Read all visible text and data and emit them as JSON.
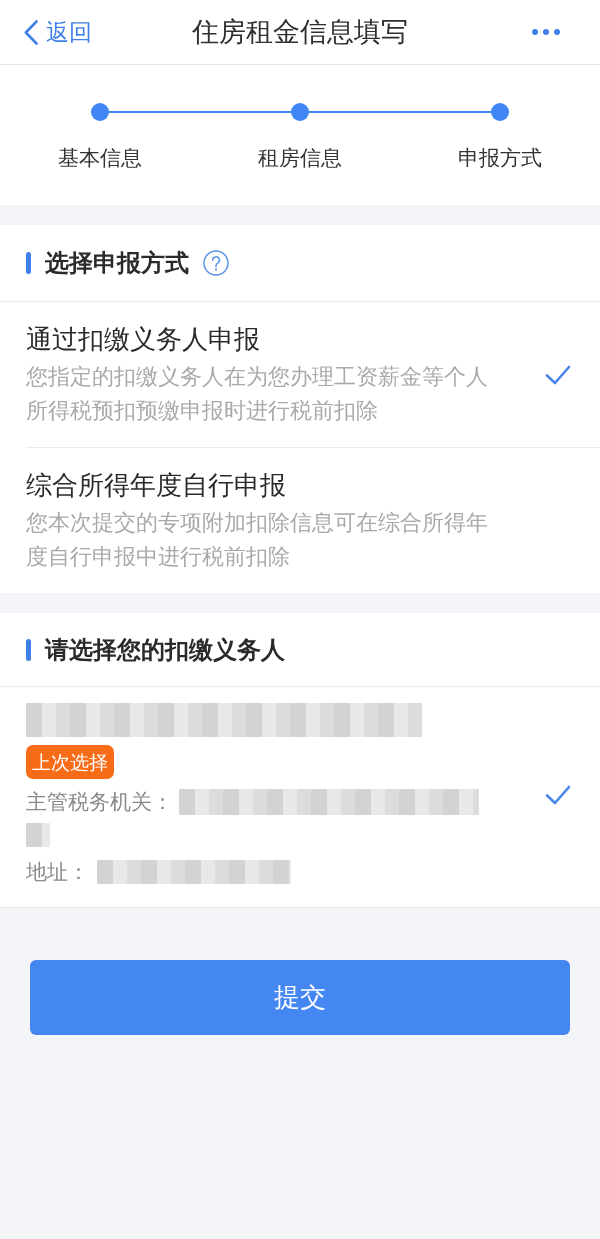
{
  "header": {
    "back_label": "返回",
    "title": "住房租金信息填写"
  },
  "steps": [
    {
      "label": "基本信息",
      "completed": true
    },
    {
      "label": "租房信息",
      "completed": true
    },
    {
      "label": "申报方式",
      "completed": true
    }
  ],
  "report_method": {
    "heading": "选择申报方式",
    "options": [
      {
        "title": "通过扣缴义务人申报",
        "description": "您指定的扣缴义务人在为您办理工资薪金等个人所得税预扣预缴申报时进行税前扣除",
        "selected": true
      },
      {
        "title": "综合所得年度自行申报",
        "description": "您本次提交的专项附加扣除信息可在综合所得年度自行申报中进行税前扣除",
        "selected": false
      }
    ]
  },
  "withholding_agent": {
    "heading": "请选择您的扣缴义务人",
    "agents": [
      {
        "badge": "上次选择",
        "authority_label": "主管税务机关：",
        "address_label": "地址：",
        "selected": true
      }
    ]
  },
  "submit_button": "提交"
}
